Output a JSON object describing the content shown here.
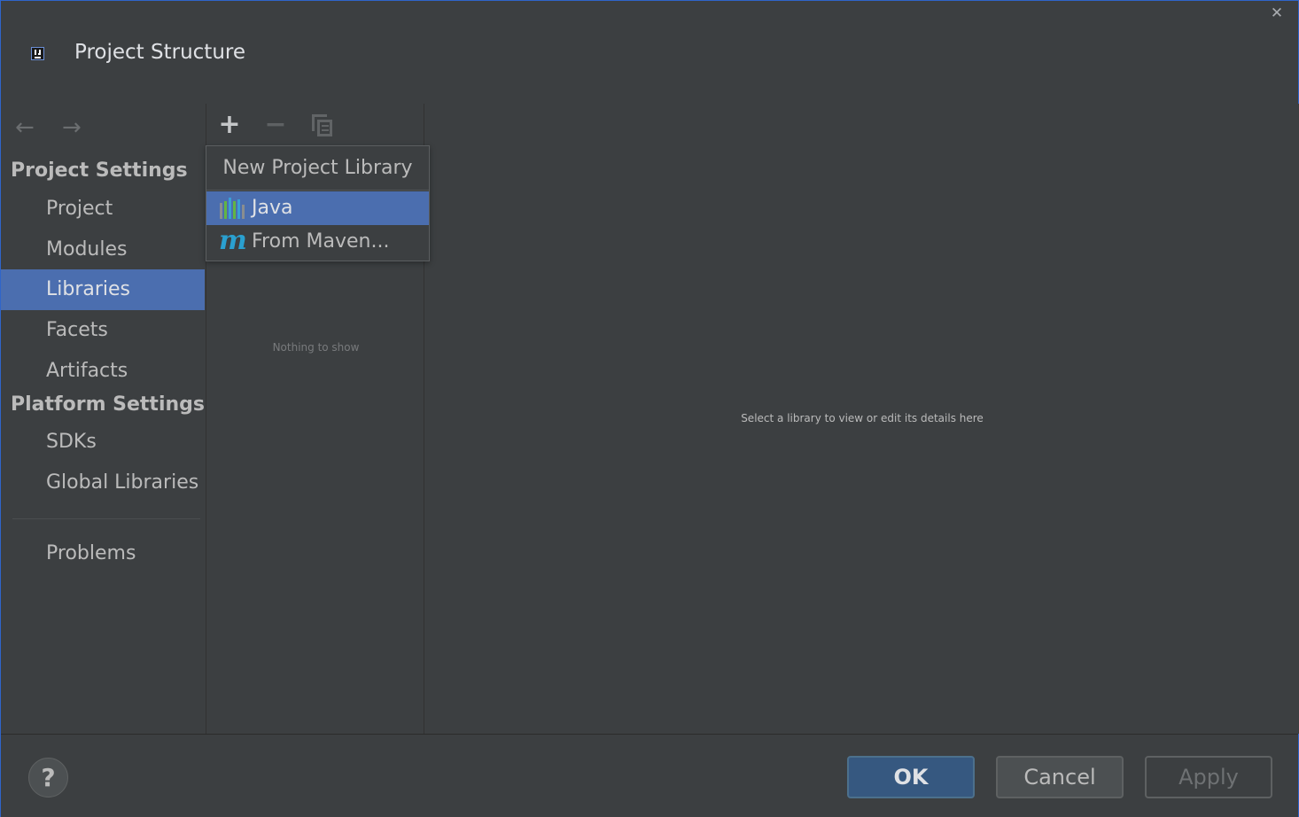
{
  "window": {
    "title": "Project Structure",
    "close_label": "✕"
  },
  "nav": {
    "back_icon": "←",
    "forward_icon": "→"
  },
  "sidebar": {
    "project_settings_title": "Project Settings",
    "project_items": [
      {
        "label": "Project"
      },
      {
        "label": "Modules"
      },
      {
        "label": "Libraries"
      },
      {
        "label": "Facets"
      },
      {
        "label": "Artifacts"
      }
    ],
    "platform_settings_title": "Platform Settings",
    "platform_items": [
      {
        "label": "SDKs"
      },
      {
        "label": "Global Libraries"
      }
    ],
    "problems_label": "Problems",
    "selected": "Libraries"
  },
  "toolbar": {
    "add_icon": "+",
    "remove_icon": "−"
  },
  "libraries_list": {
    "empty_text": "Nothing to show"
  },
  "popup": {
    "header": "New Project Library",
    "items": [
      {
        "label": "Java",
        "icon": "java-library-icon",
        "selected": true
      },
      {
        "label": "From Maven...",
        "icon": "maven-icon",
        "icon_glyph": "m"
      }
    ]
  },
  "details": {
    "hint": "Select a library to view or edit its details here"
  },
  "footer": {
    "help_label": "?",
    "ok_label": "OK",
    "cancel_label": "Cancel",
    "apply_label": "Apply"
  },
  "colors": {
    "background": "#3c3f41",
    "selection": "#4b6eaf",
    "ok_button": "#365880",
    "text": "#bbbbbb",
    "maven_accent": "#2aa0d0"
  }
}
